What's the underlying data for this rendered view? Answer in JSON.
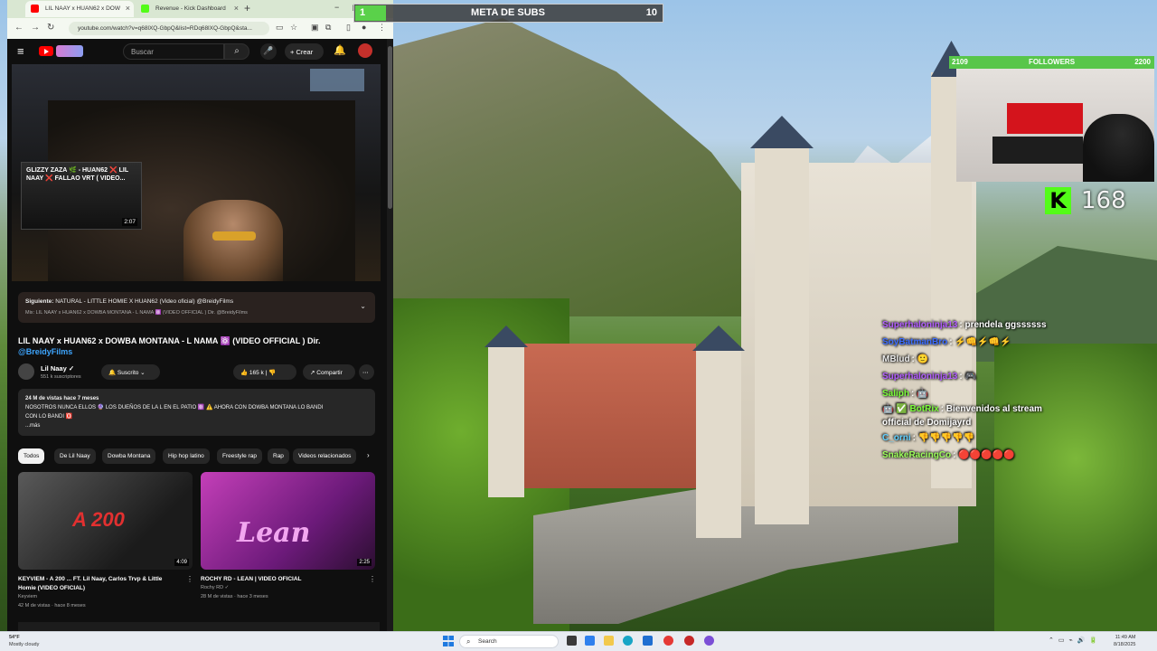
{
  "browser": {
    "tabs": [
      {
        "title": "LIL NAAY x HUAN62 x DOW",
        "active": true
      },
      {
        "title": "Revenue - Kick Dashboard",
        "active": false
      }
    ],
    "url": "youtube.com/watch?v=q68lXQ-GbpQ&list=RDq68lXQ-GbpQ&sta..."
  },
  "youtube": {
    "search_placeholder": "Buscar",
    "create_label": "+ Crear",
    "miniplayer": {
      "title": "GLIZZY ZAZA 🌿 - HUAN62 ❌ LIL NAAY ❌ FALLAO VRT ( VIDEO...",
      "duration": "2:07"
    },
    "up_next": {
      "label_prefix": "Siguiente:",
      "label_text": "NATURAL - LITTLE HOMIE X HUAN62 (Video oficial) @BreidyFilms",
      "mix": "Mix: LIL NAAY x HUAN62 x DOWBA MONTANA - L NAMA ⚛️ (VIDEO OFFICIAL ) Dir. @BreidyFilms"
    },
    "video": {
      "title": "LIL NAAY x HUAN62 x DOWBA MONTANA - L NAMA ⚛️ (VIDEO OFFICIAL ) Dir.",
      "credit": "@BreidyFilms",
      "channel": "Lil Naay ✓",
      "subscribers": "551 k suscriptores",
      "subscribed_label": "🔔 Suscrito ⌄",
      "likes": "👍 165 k  |  👎",
      "share_label": "↗ Compartir",
      "more_label": "⋯"
    },
    "description": {
      "meta": "24 M de vistas  hace 7 meses",
      "line1": "NOSOTROS NUNCA ELLOS 🔮 LOS DUEÑOS DE LA L EN EL PATIO ⚛️ ⚠️ AHORA CON DOWBA MONTANA LO BANDI",
      "line2": "CON LO BANDI 🅾️",
      "more": "...más"
    },
    "chips": [
      {
        "label": "Todos",
        "active": true
      },
      {
        "label": "De Lil Naay",
        "active": false
      },
      {
        "label": "Dowba Montana",
        "active": false
      },
      {
        "label": "Hip hop latino",
        "active": false
      },
      {
        "label": "Freestyle rap",
        "active": false
      },
      {
        "label": "Rap",
        "active": false
      },
      {
        "label": "Videos relacionados",
        "active": false
      }
    ],
    "recommendations": [
      {
        "thumb_text": "A 200",
        "duration": "4:09",
        "title": "KEYVIEM - A 200 ... FT. Lil Naay, Carlos Trvp & Little Homie (VIDEO OFICIAL)",
        "channel": "Keyviem",
        "stats": "42 M de vistas · hace 8 meses"
      },
      {
        "thumb_text": "Lean",
        "duration": "2:25",
        "title": "ROCHY RD - LEAN | VIDEO OFICIAL",
        "channel": "Rochy RD ✓",
        "stats": "28 M de vistas · hace 3 meses"
      }
    ]
  },
  "overlays": {
    "subs_goal": {
      "current": "1",
      "title": "META DE SUBS",
      "goal": "10",
      "progress": 0.1
    },
    "followers": {
      "current": "2109",
      "title": "FOLLOWERS",
      "goal": "2200"
    },
    "kick": {
      "logo": "K",
      "viewers": "168"
    },
    "chat": [
      {
        "user": "Superhaloninja13",
        "msg": ": prendela ggssssss",
        "color": "#b25cff"
      },
      {
        "user": "SoyBatmanBro",
        "msg": ": ⚡👊⚡👊⚡",
        "color": "#3b6cff"
      },
      {
        "user": "MBlud",
        "msg": ": 🙂",
        "color": "#e8e8e8"
      },
      {
        "user": "Superhaloninja13",
        "msg": ": 🎮",
        "color": "#b25cff"
      },
      {
        "user": "Saliph",
        "msg": ": 🤖",
        "color": "#7cff3a"
      },
      {
        "user": "🤖 ✅ BotRix",
        "msg": ": Bienvenidos al stream official de Domijayrd",
        "color": "#7cff3a"
      },
      {
        "user": "C_orni",
        "msg": ": 👎👎👎👎👎",
        "color": "#5fd0ff"
      },
      {
        "user": "SnakeRacingCo",
        "msg": ": 🔴🔴🔴🔴🔴",
        "color": "#9cff5a"
      }
    ]
  },
  "taskbar": {
    "weather_temp": "54°F",
    "weather_desc": "Mostly cloudy",
    "search_label": "Search",
    "time": "11:49 AM",
    "date": "8/18/2025"
  }
}
